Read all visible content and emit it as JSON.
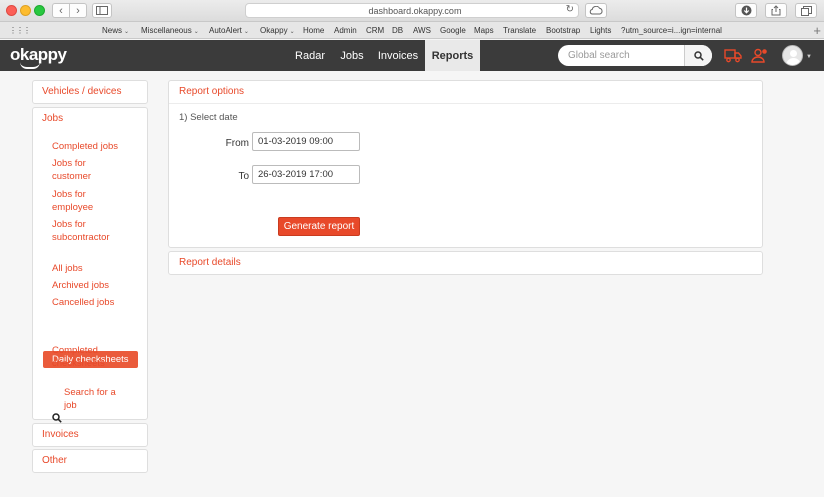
{
  "browser": {
    "url": "dashboard.okappy.com",
    "bookmarks": [
      {
        "label": "News",
        "dropdown": true
      },
      {
        "label": "Miscellaneous",
        "dropdown": true
      },
      {
        "label": "AutoAlert",
        "dropdown": true
      },
      {
        "label": "Okappy",
        "dropdown": true
      },
      {
        "label": "Home",
        "dropdown": false
      },
      {
        "label": "Admin",
        "dropdown": false
      },
      {
        "label": "CRM",
        "dropdown": false
      },
      {
        "label": "DB",
        "dropdown": false
      },
      {
        "label": "AWS",
        "dropdown": false
      },
      {
        "label": "Google",
        "dropdown": false
      },
      {
        "label": "Maps",
        "dropdown": false
      },
      {
        "label": "Translate",
        "dropdown": false
      },
      {
        "label": "Bootstrap",
        "dropdown": false
      },
      {
        "label": "Lights",
        "dropdown": false
      },
      {
        "label": "?utm_source=i...ign=internal",
        "dropdown": false
      }
    ]
  },
  "header": {
    "logo": "okappy",
    "nav": [
      {
        "label": "Radar",
        "active": false
      },
      {
        "label": "Jobs",
        "active": false
      },
      {
        "label": "Invoices",
        "active": false
      },
      {
        "label": "Reports",
        "active": true
      }
    ],
    "search_placeholder": "Global search"
  },
  "sidebar": {
    "vehicles": "Vehicles / devices",
    "jobs_heading": "Jobs",
    "jobs_links": [
      "Completed jobs",
      "Jobs for customer",
      "Jobs for employee",
      "Jobs for subcontractor",
      "All jobs",
      "Archived jobs",
      "Cancelled jobs",
      "Daily checksheets",
      "Completed checksheets"
    ],
    "search_jobs": "Search for a job",
    "invoices": "Invoices",
    "other": "Other"
  },
  "report_options": {
    "heading": "Report options",
    "step": "1) Select date",
    "from_label": "From",
    "from_value": "01-03-2019 09:00",
    "to_label": "To",
    "to_value": "26-03-2019 17:00",
    "generate_label": "Generate report"
  },
  "report_details": {
    "heading": "Report details"
  },
  "colors": {
    "accent": "#e8492a",
    "header_bg": "#3b3b3b",
    "active_item": "#ea5b3b"
  }
}
